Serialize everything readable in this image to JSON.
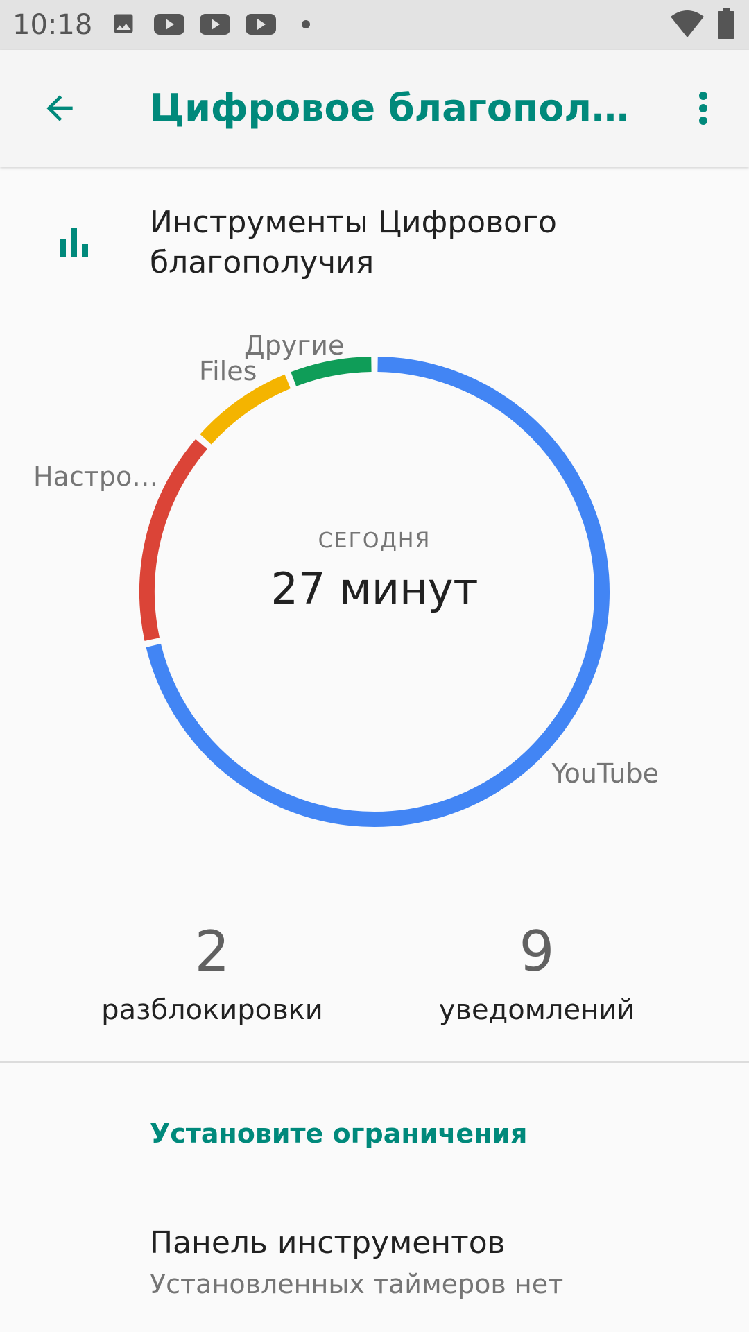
{
  "status_bar": {
    "time": "10:18",
    "icons": [
      "image-icon",
      "youtube-icon",
      "youtube-icon",
      "youtube-icon",
      "dot-icon",
      "wifi-icon",
      "battery-icon"
    ]
  },
  "app_bar": {
    "title": "Цифровое благополучи…",
    "back_icon": "arrow-back-icon",
    "menu_icon": "more-vert-icon"
  },
  "tools": {
    "icon": "bar-chart-icon",
    "title": "Инструменты Цифрового благополучия"
  },
  "colors": {
    "accent": "#00897b",
    "youtube": "#4285f4",
    "settings": "#db4437",
    "files": "#f4b400",
    "other": "#0f9d58"
  },
  "chart_data": {
    "type": "pie",
    "style": "donut",
    "center_label": "СЕГОДНЯ",
    "center_value": "27 минут",
    "slices": [
      {
        "label": "YouTube",
        "value": 19,
        "color": "#4285f4"
      },
      {
        "label": "Настро…",
        "value": 4,
        "color": "#db4437"
      },
      {
        "label": "Files",
        "value": 2,
        "color": "#f4b400"
      },
      {
        "label": "Другие",
        "value": 1.6,
        "color": "#0f9d58"
      }
    ]
  },
  "stats": {
    "unlocks": {
      "value": "2",
      "label": "разблокировки"
    },
    "notifications": {
      "value": "9",
      "label": "уведомлений"
    }
  },
  "limits": {
    "header": "Установите ограничения",
    "dashboard_title": "Панель инструментов",
    "dashboard_summary": "Установленных таймеров нет"
  }
}
